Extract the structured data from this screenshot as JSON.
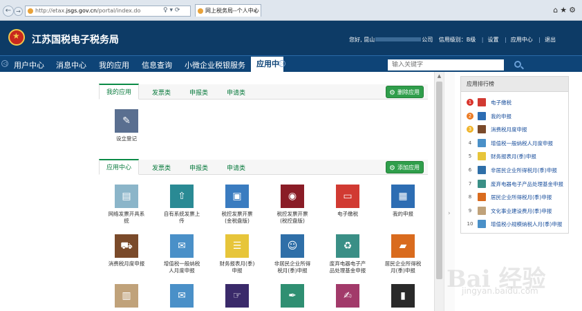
{
  "browser": {
    "url_prefix": "http://etax.",
    "url_domain": "jsgs.gov.cn",
    "url_suffix": "/portal/index.do",
    "addr_tools": "♀ ▾ ⟳",
    "tab_title": "网上税务局--个人中心",
    "tab_close": "×",
    "right_icons": "⌂★⚙",
    "back": "←",
    "forward": "→"
  },
  "header": {
    "site_title": "江苏国税电子税务局",
    "greeting": "您好, 昆山",
    "company_suffix": "公司",
    "credit_label": "信用级别：B级",
    "links": [
      "设置",
      "应用中心",
      "退出"
    ]
  },
  "nav": {
    "left_arrow": "◁",
    "right_arrow": "▷",
    "items": [
      "用户中心",
      "消息中心",
      "我的应用",
      "信息查询",
      "小微企业税银服务"
    ],
    "active": "应用中",
    "search_placeholder": "输入关键字"
  },
  "my_apps": {
    "tabs": [
      "我的应用",
      "发票类",
      "申报类",
      "申请类"
    ],
    "delete_label": "删除应用",
    "apps": [
      {
        "label": "设立登记",
        "icon": "pencil-icon",
        "color": "#5a6f90"
      }
    ]
  },
  "app_center": {
    "tabs": [
      "应用中心",
      "发票类",
      "申报类",
      "申请类"
    ],
    "add_label": "添加应用",
    "apps": [
      {
        "label": "网络发票开具系\n统",
        "icon": "invoice-icon",
        "color": "#8bb5c9"
      },
      {
        "label": "自有系统发票上\n传",
        "icon": "upload-icon",
        "color": "#2a8a94"
      },
      {
        "label": "税控发票开票\n(金税盘版)",
        "icon": "tax-disk-icon",
        "color": "#3a7cc0"
      },
      {
        "label": "税控发票开票\n(税控盘版)",
        "icon": "tax-disc-icon",
        "color": "#8a1c26"
      },
      {
        "label": "电子缴税",
        "icon": "monitor-icon",
        "color": "#d13a32"
      },
      {
        "label": "我的申报",
        "icon": "declare-icon",
        "color": "#2d6db3"
      },
      {
        "label": "消费税月度申报",
        "icon": "cart-icon",
        "color": "#7a4a2a"
      },
      {
        "label": "增值税一般纳税\n人月度申报",
        "icon": "vat-icon",
        "color": "#4a90c8"
      },
      {
        "label": "财务报表月(季)\n申报",
        "icon": "report-icon",
        "color": "#e7c53a"
      },
      {
        "label": "非居民企业所得\n税月(季)申报",
        "icon": "person-icon",
        "color": "#2f6fa8"
      },
      {
        "label": "废弃电器电子产\n品处理基金申报",
        "icon": "bin-icon",
        "color": "#3a8f86"
      },
      {
        "label": "居民企业所得税\n月(季)申报",
        "icon": "briefcase-icon",
        "color": "#d96b1e"
      },
      {
        "label": "",
        "icon": "film-icon",
        "color": "#c0a27a"
      },
      {
        "label": "",
        "icon": "ticket-icon",
        "color": "#4a90c8"
      },
      {
        "label": "",
        "icon": "hand-icon",
        "color": "#3a2a6a"
      },
      {
        "label": "",
        "icon": "pen-icon",
        "color": "#2f8f72"
      },
      {
        "label": "",
        "icon": "edit-doc-icon",
        "color": "#a23a6a"
      },
      {
        "label": "",
        "icon": "equalizer-icon",
        "color": "#2a2a2a"
      }
    ]
  },
  "ranking": {
    "title": "应用排行榜",
    "items": [
      {
        "num": "1",
        "label": "电子缴税",
        "color": "#d13a32"
      },
      {
        "num": "2",
        "label": "我的申报",
        "color": "#2d6db3"
      },
      {
        "num": "3",
        "label": "消费税月度申报",
        "color": "#7a4a2a"
      },
      {
        "num": "4",
        "label": "增值税一般纳税人月度申报",
        "color": "#4a90c8"
      },
      {
        "num": "5",
        "label": "财务报表月(季)申报",
        "color": "#e7c53a"
      },
      {
        "num": "6",
        "label": "非居民企业所得税月(季)申报",
        "color": "#2f6fa8"
      },
      {
        "num": "7",
        "label": "废弃电器电子产品处理基金申报",
        "color": "#3a8f86"
      },
      {
        "num": "8",
        "label": "居民企业所得税月(季)申报",
        "color": "#d96b1e"
      },
      {
        "num": "9",
        "label": "文化事业建设费月(季)申报",
        "color": "#c0a27a"
      },
      {
        "num": "10",
        "label": "增值税小规模纳税人月(季)申报",
        "color": "#4a90c8"
      }
    ]
  },
  "watermark": {
    "main": "Bai 经验",
    "sub": "jingyan.baidu.com"
  }
}
